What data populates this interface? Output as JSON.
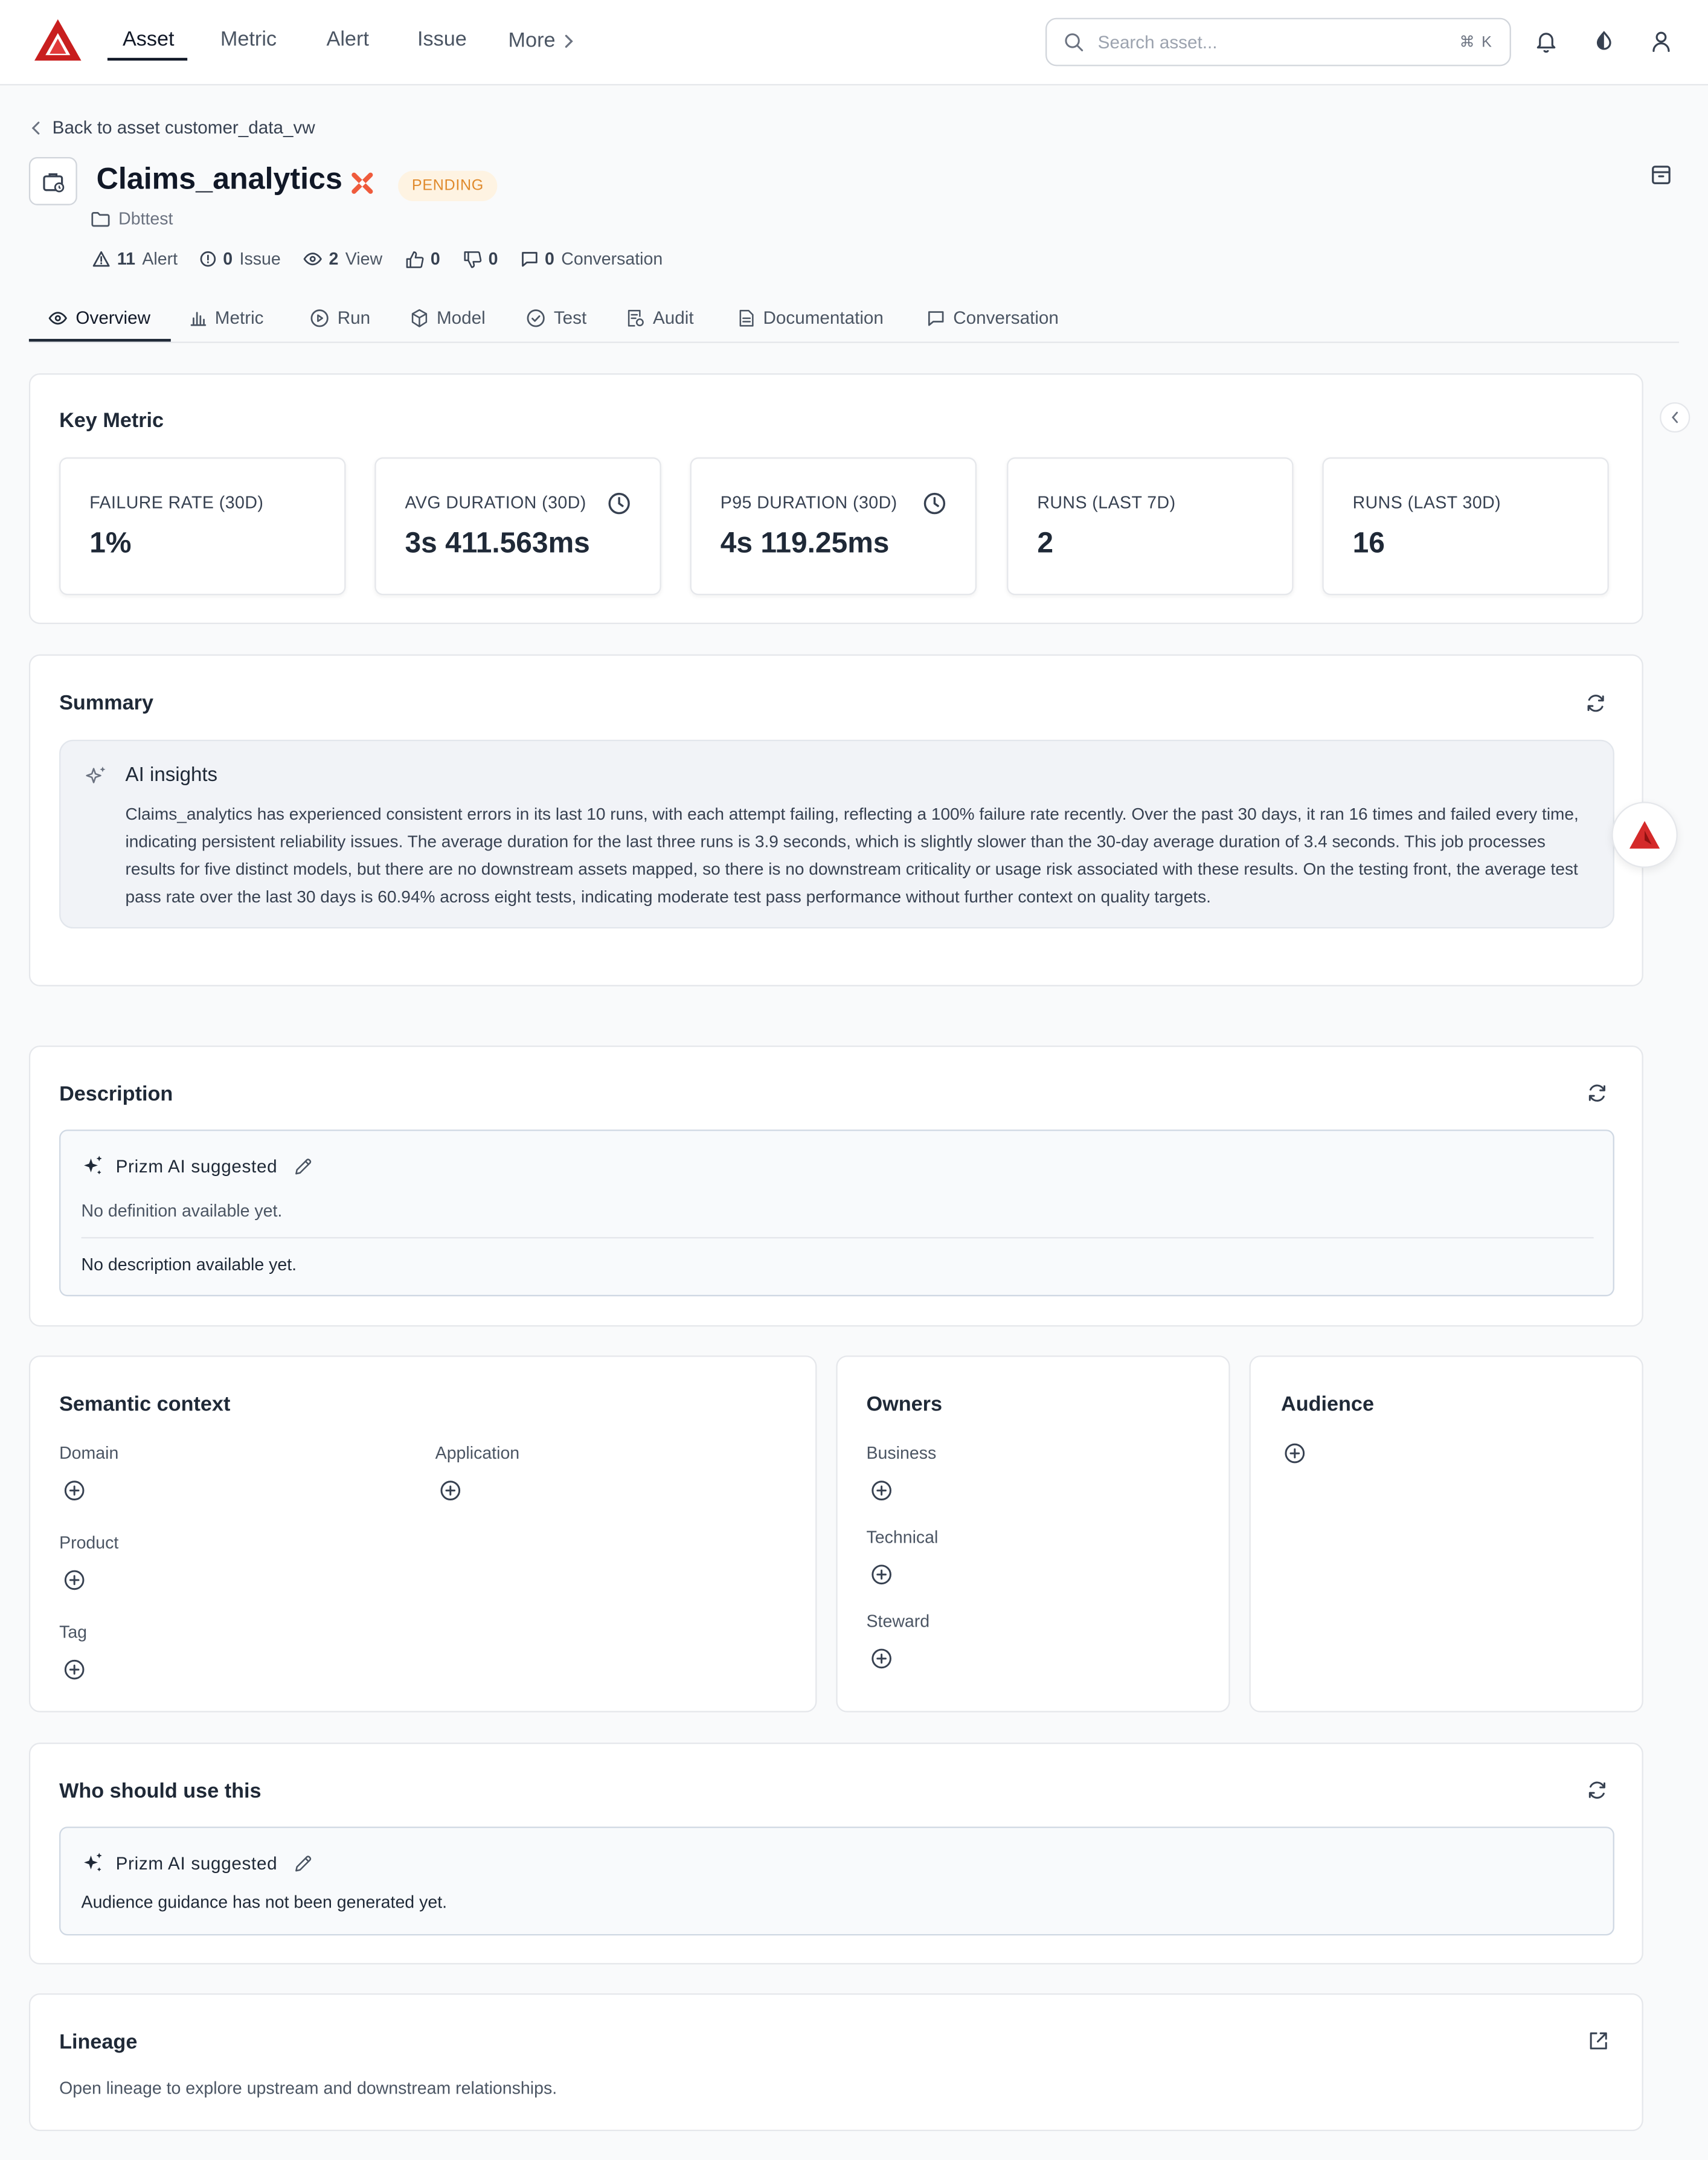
{
  "nav": {
    "items": [
      "Asset",
      "Metric",
      "Alert",
      "Issue"
    ],
    "more": "More",
    "search_placeholder": "Search asset...",
    "search_shortcut": "⌘ K"
  },
  "breadcrumb": {
    "back": "Back to asset customer_data_vw"
  },
  "asset": {
    "title": "Claims_analytics",
    "status": "PENDING",
    "folder": "Dbttest",
    "stats": {
      "alerts_count": "11",
      "alerts_label": "Alert",
      "issues_count": "0",
      "issues_label": "Issue",
      "views_count": "2",
      "views_label": "View",
      "likes": "0",
      "dislikes": "0",
      "conversations_count": "0",
      "conversations_label": "Conversation"
    }
  },
  "tabs": [
    "Overview",
    "Metric",
    "Run",
    "Model",
    "Test",
    "Audit",
    "Documentation",
    "Conversation"
  ],
  "key_metric": {
    "title": "Key Metric",
    "metrics": [
      {
        "label": "FAILURE RATE (30D)",
        "value": "1%"
      },
      {
        "label": "AVG DURATION (30D)",
        "value": "3s 411.563ms"
      },
      {
        "label": "P95 DURATION (30D)",
        "value": "4s 119.25ms"
      },
      {
        "label": "RUNS (LAST 7D)",
        "value": "2"
      },
      {
        "label": "RUNS (LAST 30D)",
        "value": "16"
      }
    ]
  },
  "summary": {
    "title": "Summary",
    "insights_title": "AI insights",
    "insights_text": "Claims_analytics has experienced consistent errors in its last 10 runs, with each attempt failing, reflecting a 100% failure rate recently. Over the past 30 days, it ran 16 times and failed every time, indicating persistent reliability issues. The average duration for the last three runs is 3.9 seconds, which is slightly slower than the 30-day average duration of 3.4 seconds. This job processes results for five distinct models, but there are no downstream assets mapped, so there is no downstream criticality or usage risk associated with these results. On the testing front, the average test pass rate over the last 30 days is 60.94% across eight tests, indicating moderate test pass performance without further context on quality targets."
  },
  "description": {
    "title": "Description",
    "suggested_label": "Prizm AI suggested",
    "definition": "No definition available yet.",
    "body": "No description available yet."
  },
  "semantic": {
    "title": "Semantic context",
    "domain": "Domain",
    "application": "Application",
    "product": "Product",
    "tag": "Tag"
  },
  "owners": {
    "title": "Owners",
    "business": "Business",
    "technical": "Technical",
    "steward": "Steward"
  },
  "audience": {
    "title": "Audience"
  },
  "who": {
    "title": "Who should use this",
    "suggested_label": "Prizm AI suggested",
    "text": "Audience guidance has not been generated yet."
  },
  "lineage": {
    "title": "Lineage",
    "text": "Open lineage to explore upstream and downstream relationships."
  },
  "colors": {
    "brand": "#d42a2a",
    "pending_bg": "#fef3e2",
    "pending_text": "#e08a2c",
    "error": "#ef5b3c"
  }
}
